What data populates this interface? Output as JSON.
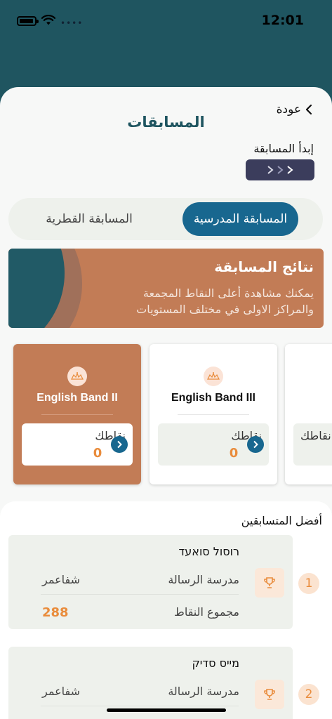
{
  "status_bar": {
    "time": "12:01"
  },
  "header": {
    "back_label": "عودة",
    "title": "المسابقات"
  },
  "start": {
    "label": "إبدأ المسابقة"
  },
  "tabs": [
    {
      "label": "المسابقة المدرسية",
      "active": true
    },
    {
      "label": "المسابقة القطرية",
      "active": false
    }
  ],
  "banner": {
    "title": "نتائج المسابقة",
    "description": "يمكنك مشاهدة أعلى النقاط المجمعة والمراكز الاولى في مختلف المستويات"
  },
  "levels": [
    {
      "name": "English Band II",
      "points_label": "نقاطك",
      "points": "0",
      "active": true
    },
    {
      "name": "English Band III",
      "points_label": "نقاطك",
      "points": "0",
      "active": false
    },
    {
      "name": "",
      "points_label": "نقاطك",
      "points": "",
      "active": false
    }
  ],
  "leaders": {
    "title": "أفضل المتسابقين",
    "items": [
      {
        "rank": "1",
        "name": "רוסול סואעד",
        "school_label": "مدرسة الرسالة",
        "city": "شفاعمر",
        "total_label": "مجموع النقاط",
        "total": "288"
      },
      {
        "rank": "2",
        "name": "מייס סדיק",
        "school_label": "مدرسة الرسالة",
        "city": "شفاعمر"
      }
    ]
  },
  "colors": {
    "brand_dark": "#1f5560",
    "accent_blue": "#18678f",
    "accent_orange": "#c27c56",
    "points_orange": "#e98c3c"
  },
  "icons": [
    "battery-icon",
    "wifi-icon",
    "back-chevron-icon",
    "chevron-right-icon",
    "level-badge-icon",
    "trophy-icon"
  ]
}
